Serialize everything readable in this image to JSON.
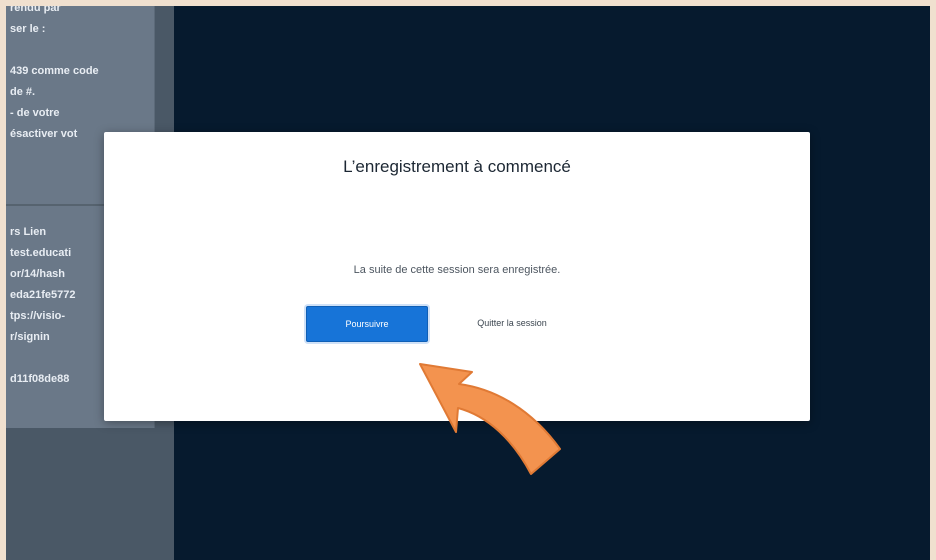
{
  "sidebar": {
    "lines_top": [
      "rendu par",
      "ser le :",
      "",
      "439 comme code",
      " de #.",
      "- de votre",
      "ésactiver vot"
    ],
    "lines_bottom": [
      "rs Lien",
      "test.educati",
      "or/14/hash",
      "eda21fe5772",
      "tps://visio-",
      "r/signin",
      "",
      "d11f08de88"
    ]
  },
  "modal": {
    "title": "L’enregistrement à commencé",
    "message": "La suite de cette session sera enregistrée.",
    "continue_label": "Poursuivre",
    "quit_label": "Quitter la session"
  },
  "colors": {
    "primary_button": "#1774d8",
    "background": "#061a2e",
    "pointer_arrow": "#f3934f"
  },
  "icons": {
    "pointer": "curved-arrow-icon"
  }
}
